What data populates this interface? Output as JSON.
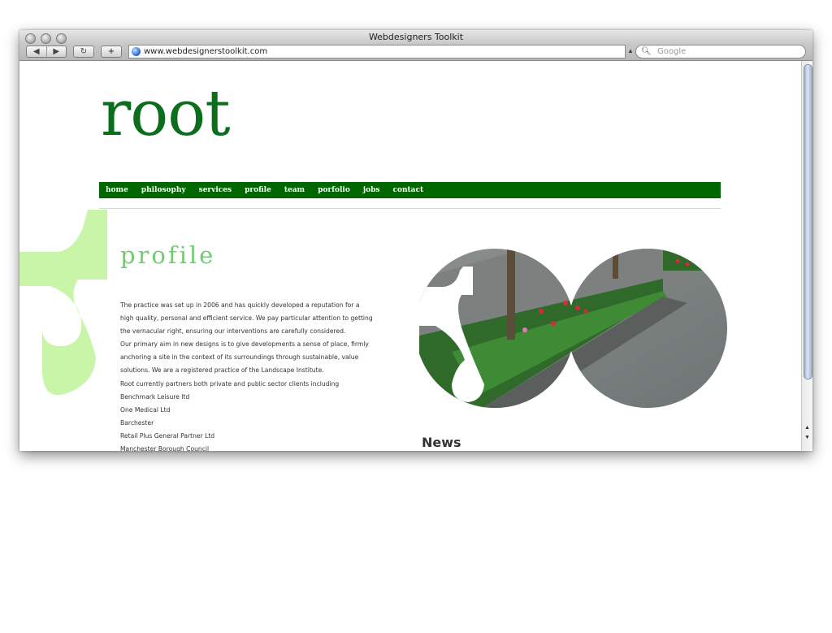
{
  "browser": {
    "window_title": "Webdesigners Toolkit",
    "url": "www.webdesignerstoolkit.com",
    "search_placeholder": "Google",
    "back_glyph": "◀",
    "forward_glyph": "▶",
    "reload_glyph": "↻",
    "add_bookmark_glyph": "+"
  },
  "site": {
    "logo": "root",
    "nav": [
      "home",
      "philosophy",
      "services",
      "profile",
      "team",
      "porfolio",
      "jobs",
      "contact"
    ],
    "page_heading": "profile",
    "profile_lines": [
      "The practice was set up in 2006 and has quickly developed a reputation for a",
      "high quality, personal and efficient service. We pay particular attention to getting",
      "the vernacular right, ensuring our interventions are carefully considered.",
      "Our primary aim in new designs is to give developments a sense of place, firmly",
      "anchoring a site in the context of its surroundings through sustainable, value",
      "solutions. We are a registered practice of the Landscape Institute.",
      "Root currently partners both private and public sector clients including",
      "Benchmark Leisure ltd",
      "One Medical Ltd",
      "Barchester",
      "Retail Plus General Partner Ltd",
      "Manchester Borough Council"
    ],
    "news_heading": "News"
  },
  "colors": {
    "brand_green": "#006600",
    "logo_green": "#0b6e1c",
    "heading_green": "#6fcc6f",
    "accent_light_green": "#c8f5a8"
  },
  "icons": {
    "search": "magnifier-icon",
    "site": "globe-icon"
  }
}
